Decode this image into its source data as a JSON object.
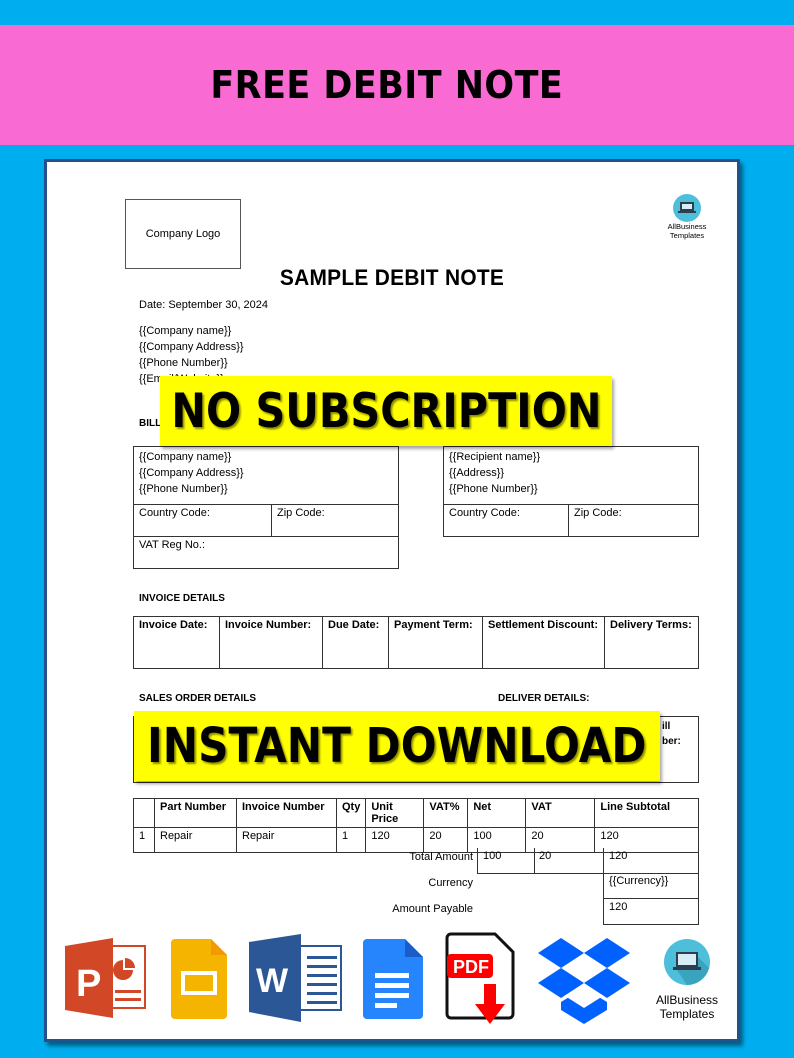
{
  "banner": {
    "title": "FREE DEBIT NOTE"
  },
  "document": {
    "logo_placeholder": "Company Logo",
    "brand": {
      "line1": "AllBusiness",
      "line2": "Templates"
    },
    "title": "SAMPLE DEBIT NOTE",
    "date": "Date: September 30, 2024",
    "company": [
      "{{Company name}}",
      "{{Company Address}}",
      "{{Phone Number}}",
      "{{Email/Website}}"
    ],
    "bill_to": {
      "label": "BILL TO",
      "lines": [
        "{{Company name}}",
        "{{Company Address}}",
        "{{Phone Number}}"
      ],
      "country_code": "Country Code:",
      "zip_code": "Zip Code:",
      "vat_reg": "VAT Reg No.:"
    },
    "ship_to": {
      "lines": [
        "{{Recipient name}}",
        "{{Address}}",
        "{{Phone Number}}"
      ],
      "country_code": "Country Code:",
      "zip_code": "Zip Code:"
    },
    "invoice_details": {
      "label": "INVOICE DETAILS",
      "headers": [
        "Invoice Date:",
        "Invoice Number:",
        "Due Date:",
        "Payment Term:",
        "Settlement Discount:",
        "Delivery Terms:"
      ]
    },
    "sales_order": {
      "label": "SALES ORDER DETAILS",
      "deliver_label": "DELIVER DETAILS:",
      "partial_visible": [
        "ill",
        "ber:"
      ]
    },
    "line_items": {
      "headers": [
        "",
        "Part Number",
        "Invoice Number",
        "Qty",
        "Unit Price",
        "VAT%",
        "Net",
        "VAT",
        "Line Subtotal"
      ],
      "rows": [
        [
          "1",
          "Repair",
          "Repair",
          "1",
          "120",
          "20",
          "100",
          "20",
          "120"
        ]
      ],
      "totals": {
        "total_label": "Total Amount",
        "total_net": "100",
        "total_vat": "20",
        "total_subtotal": "120",
        "currency_label": "Currency",
        "currency_value": "{{Currency}}",
        "payable_label": "Amount Payable",
        "payable_value": "120"
      }
    }
  },
  "overlays": {
    "no_subscription": "NO SUBSCRIPTION",
    "instant_download": "INSTANT DOWNLOAD"
  },
  "format_icons": [
    {
      "name": "powerpoint-icon",
      "color": "#D24726"
    },
    {
      "name": "google-slides-icon",
      "color": "#F4B400"
    },
    {
      "name": "word-icon",
      "color": "#2B5797"
    },
    {
      "name": "google-docs-icon",
      "color": "#2684FC"
    },
    {
      "name": "pdf-download-icon",
      "label": "PDF",
      "color": "#FF0000"
    },
    {
      "name": "dropbox-icon",
      "color": "#0061FE"
    },
    {
      "name": "allbusiness-templates-icon",
      "line1": "AllBusiness",
      "line2": "Templates"
    }
  ],
  "colors": {
    "background": "#00AEEF",
    "banner": "#F96BD3",
    "highlight": "#FFFF00",
    "sheet_border": "#24518A"
  }
}
